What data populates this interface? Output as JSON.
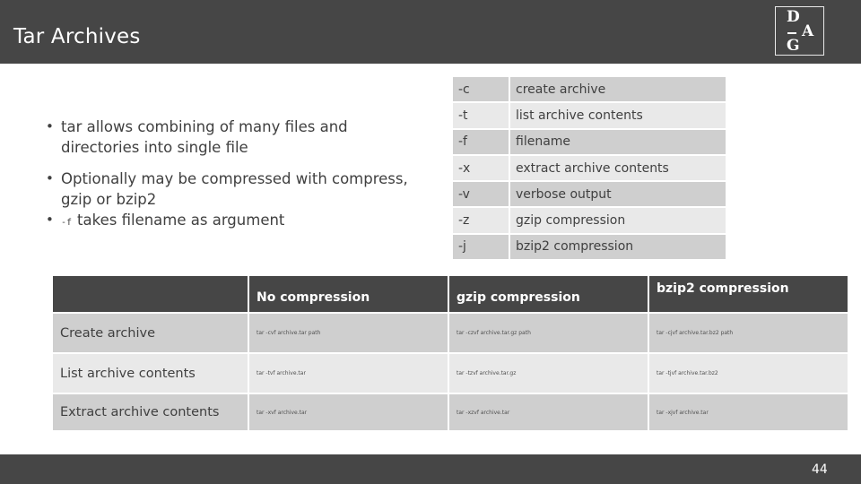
{
  "header": {
    "title": "Tar Archives",
    "logo": {
      "letters": [
        "D",
        "A",
        "G"
      ]
    }
  },
  "bullets": [
    {
      "text": "tar allows combining of many files and directories into single file"
    },
    {
      "text": "Optionally may be compressed with compress, gzip or bzip2"
    },
    {
      "code": "-f",
      "text": "takes filename as argument"
    }
  ],
  "options_table": {
    "rows": [
      {
        "flag": "-c",
        "description": "create archive"
      },
      {
        "flag": "-t",
        "description": "list archive contents"
      },
      {
        "flag": "-f",
        "description": "filename"
      },
      {
        "flag": "-x",
        "description": "extract archive contents"
      },
      {
        "flag": "-v",
        "description": "verbose output"
      },
      {
        "flag": "-z",
        "description": "gzip compression"
      },
      {
        "flag": "-j",
        "description": "bzip2 compression"
      }
    ]
  },
  "compression_table": {
    "headers": [
      "",
      "No compression",
      "gzip compression",
      "bzip2 compression"
    ],
    "rows": [
      {
        "label": "Create archive",
        "cells": [
          "tar -cvf archive.tar path",
          "tar -czvf archive.tar.gz path",
          "tar -cjvf archive.tar.bz2 path"
        ]
      },
      {
        "label": "List archive contents",
        "cells": [
          "tar -tvf archive.tar",
          "tar -tzvf archive.tar.gz",
          "tar -tjvf archive.tar.bz2"
        ]
      },
      {
        "label": "Extract archive contents",
        "cells": [
          "tar -xvf archive.tar",
          "tar -xzvf archive.tar",
          "tar -xjvf archive.tar"
        ]
      }
    ]
  },
  "footer": {
    "page_number": "44"
  },
  "colors": {
    "bar": "#464646",
    "row_dark": "#cfcfcf",
    "row_light": "#e9e9e9",
    "text": "#404040"
  }
}
